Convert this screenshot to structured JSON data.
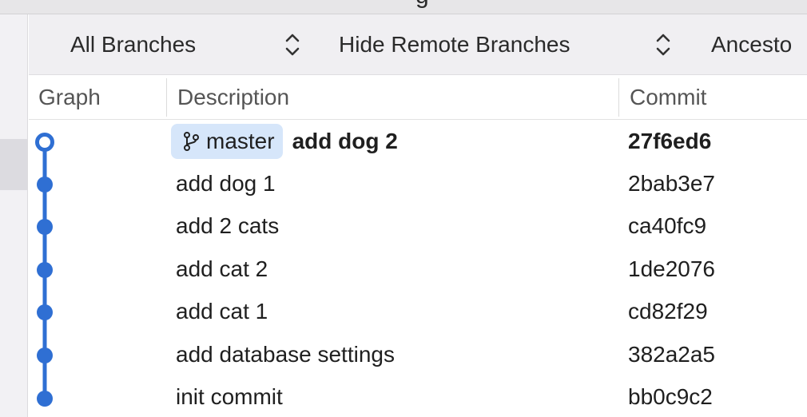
{
  "window": {
    "title_fragment": "g"
  },
  "toolbar": {
    "branches_select": "All Branches",
    "remote_select": "Hide Remote Branches",
    "order_select": "Ancesto"
  },
  "columns": {
    "graph": "Graph",
    "description": "Description",
    "commit": "Commit"
  },
  "commits": [
    {
      "branch": "master",
      "description": "add dog 2",
      "hash": "27f6ed6",
      "head": true
    },
    {
      "description": "add dog 1",
      "hash": "2bab3e7"
    },
    {
      "description": "add 2 cats",
      "hash": "ca40fc9"
    },
    {
      "description": "add cat 2",
      "hash": "1de2076"
    },
    {
      "description": "add cat 1",
      "hash": "cd82f29"
    },
    {
      "description": "add database settings",
      "hash": "382a2a5"
    },
    {
      "description": "init commit",
      "hash": "bb0c9c2"
    }
  ],
  "colors": {
    "graph": "#2f6fd3",
    "branch_pill": "#d6e6fa"
  },
  "icons": {
    "branch": "git-branch-icon",
    "popup": "chevron-up-down-icon"
  }
}
